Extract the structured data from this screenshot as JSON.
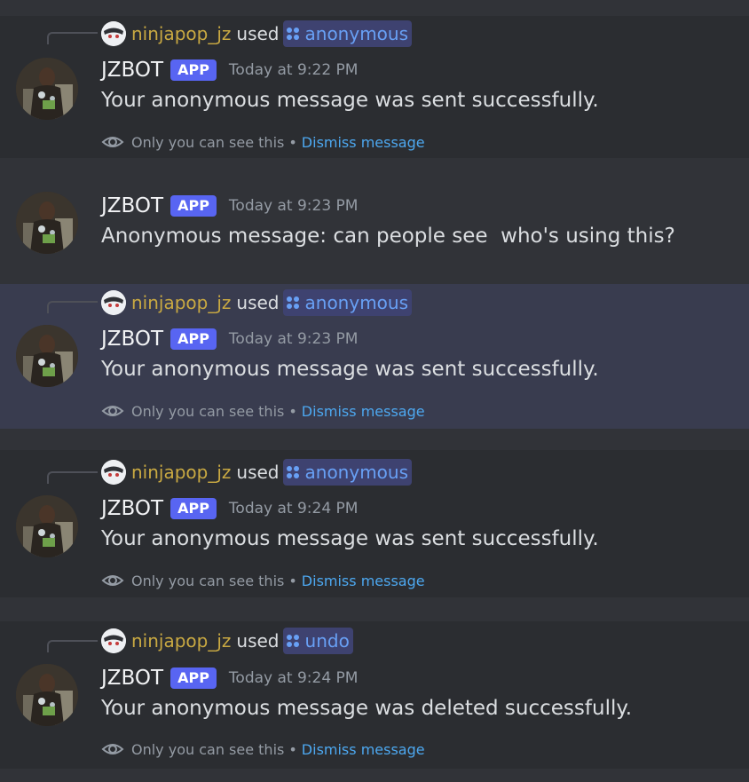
{
  "messages": [
    {
      "reply": {
        "user": "ninjapop_jz",
        "used": "used",
        "command": "anonymous"
      },
      "author": "JZBOT",
      "tag": "APP",
      "timestamp": "Today at 9:22 PM",
      "content": "Your anonymous message was sent successfully.",
      "ephemeral": {
        "notice": "Only you can see this",
        "separator": "•",
        "dismiss": "Dismiss message"
      }
    },
    {
      "author": "JZBOT",
      "tag": "APP",
      "timestamp": "Today at 9:23 PM",
      "content": "Anonymous message: can people see  who's using this?"
    },
    {
      "reply": {
        "user": "ninjapop_jz",
        "used": "used",
        "command": "anonymous"
      },
      "author": "JZBOT",
      "tag": "APP",
      "timestamp": "Today at 9:23 PM",
      "content": "Your anonymous message was sent successfully.",
      "ephemeral": {
        "notice": "Only you can see this",
        "separator": "•",
        "dismiss": "Dismiss message"
      }
    },
    {
      "reply": {
        "user": "ninjapop_jz",
        "used": "used",
        "command": "anonymous"
      },
      "author": "JZBOT",
      "tag": "APP",
      "timestamp": "Today at 9:24 PM",
      "content": "Your anonymous message was sent successfully.",
      "ephemeral": {
        "notice": "Only you can see this",
        "separator": "•",
        "dismiss": "Dismiss message"
      }
    },
    {
      "reply": {
        "user": "ninjapop_jz",
        "used": "used",
        "command": "undo"
      },
      "author": "JZBOT",
      "tag": "APP",
      "timestamp": "Today at 9:24 PM",
      "content": "Your anonymous message was deleted successfully.",
      "ephemeral": {
        "notice": "Only you can see this",
        "separator": "•",
        "dismiss": "Dismiss message"
      }
    }
  ],
  "colors": {
    "background": "#313338",
    "ephemeral_background": "#2b2d31",
    "highlight_background": "#393c4f",
    "app_tag": "#5865f2",
    "reply_username": "#c9a942",
    "command_text": "#68a0f5",
    "dismiss_link": "#4da8f0"
  },
  "icons": {
    "eye": "eye-icon",
    "command": "slash-command-icon",
    "bot_avatar": "bot-avatar",
    "user_avatar": "user-avatar"
  }
}
